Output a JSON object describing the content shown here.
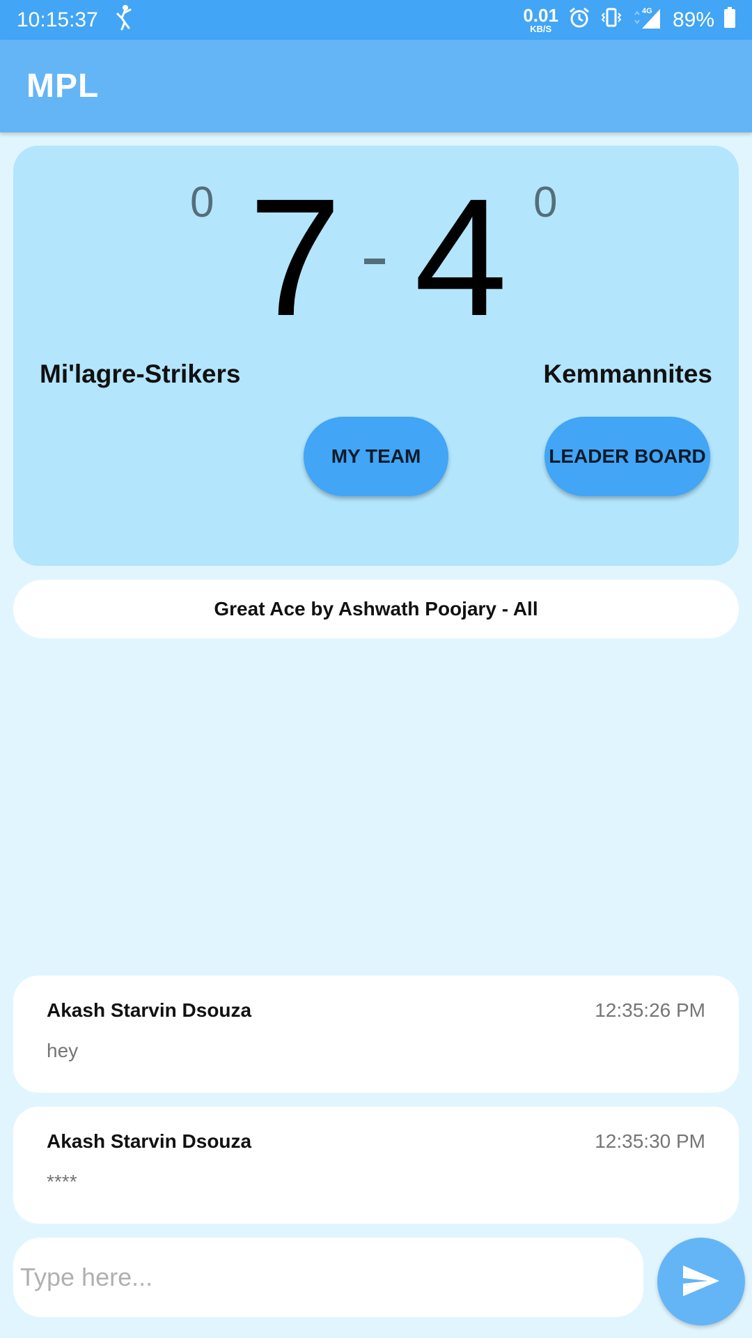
{
  "status_bar": {
    "time": "10:15:37",
    "net_speed_value": "0.01",
    "net_speed_unit": "KB/S",
    "network": "4G",
    "battery": "89%"
  },
  "app_bar": {
    "title": "MPL"
  },
  "scoreboard": {
    "home_sets": "0",
    "away_sets": "0",
    "home_score": "7",
    "away_score": "4",
    "home_team": "Mi'lagre-Strikers",
    "away_team": "Kemmannites",
    "my_team_label": "MY TEAM",
    "leader_board_label": "LEADER BOARD"
  },
  "banner": {
    "text": "Great Ace by Ashwath Poojary - All"
  },
  "messages": [
    {
      "sender": "Akash Starvin Dsouza",
      "time": "12:35:26 PM",
      "text": "hey"
    },
    {
      "sender": "Akash Starvin Dsouza",
      "time": "12:35:30 PM",
      "text": "****"
    }
  ],
  "composer": {
    "placeholder": "Type here..."
  },
  "colors": {
    "status_bar": "#42a5f5",
    "app_bar": "#64b5f6",
    "score_card": "#b3e5fc",
    "background": "#e1f5fe",
    "button": "#42a5f5"
  }
}
